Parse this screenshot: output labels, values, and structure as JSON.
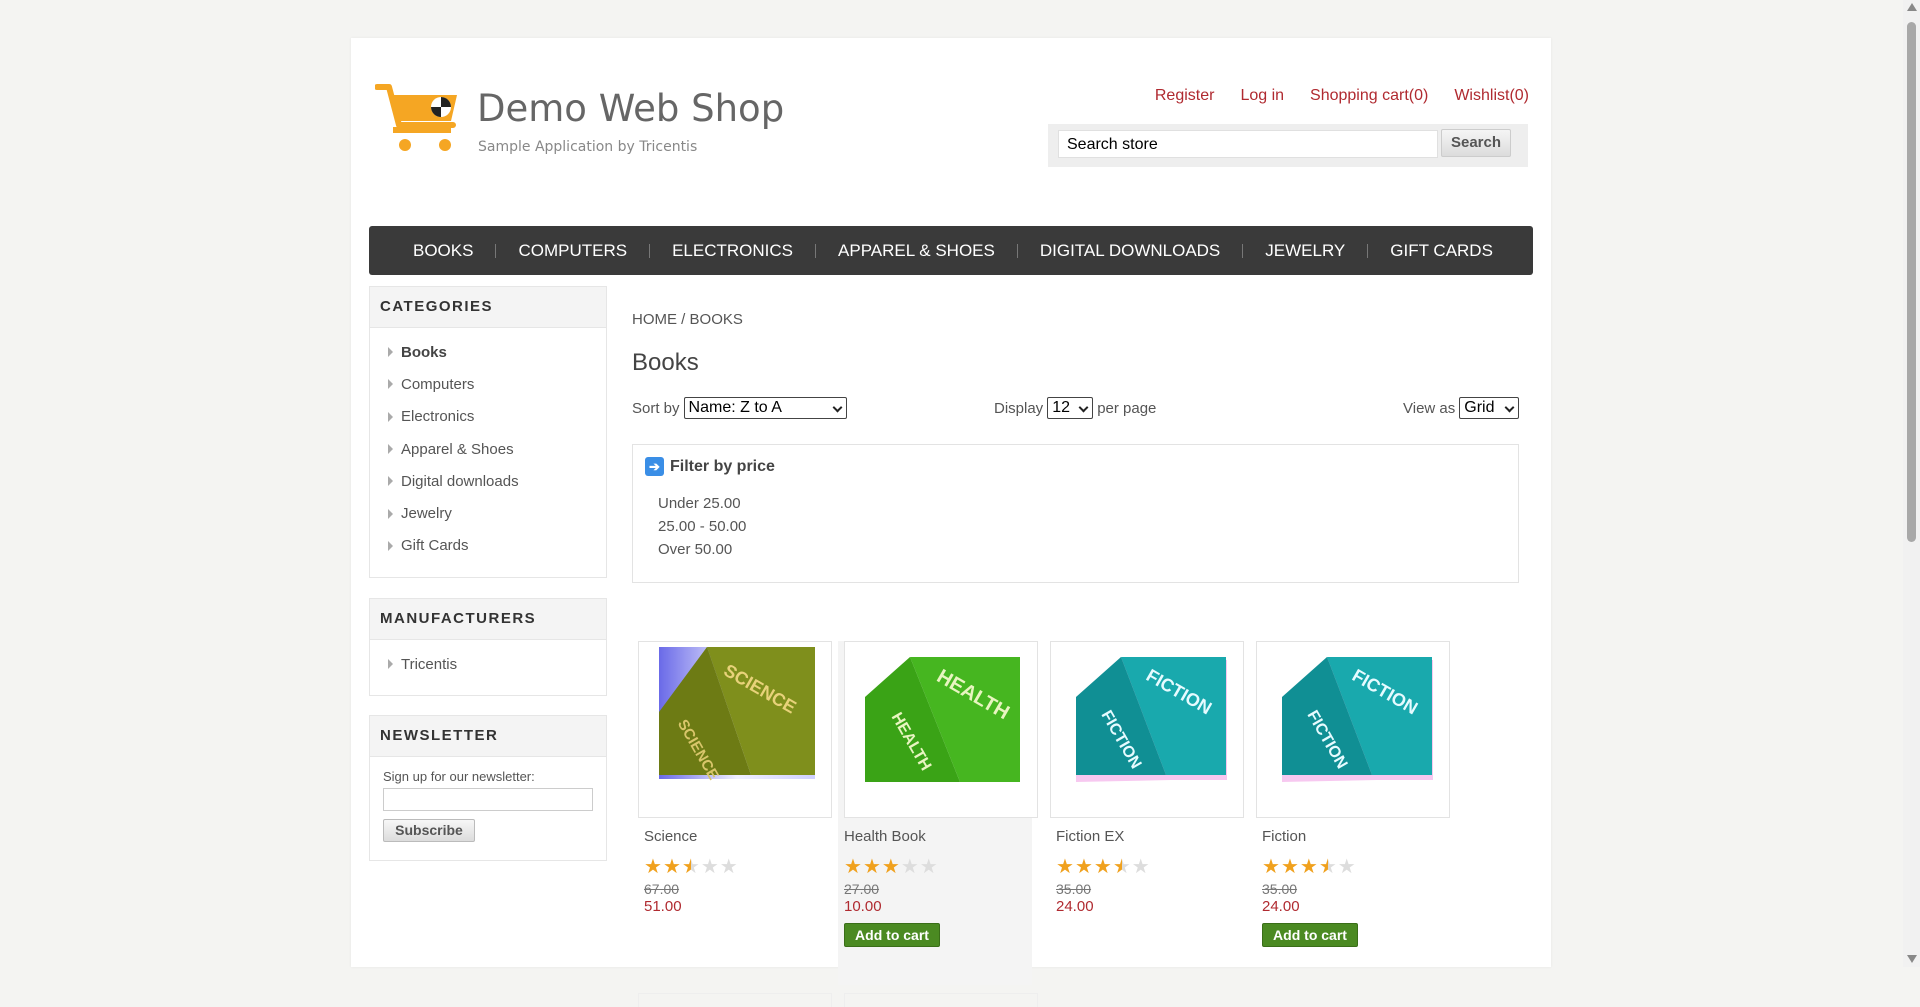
{
  "header": {
    "logo_title": "Demo Web Shop",
    "logo_subtitle": "Sample Application by Tricentis",
    "links": [
      "Register",
      "Log in",
      "Shopping cart(0)",
      "Wishlist(0)"
    ],
    "search_value": "Search store",
    "search_button": "Search"
  },
  "top_menu": [
    "BOOKS",
    "COMPUTERS",
    "ELECTRONICS",
    "APPAREL & SHOES",
    "DIGITAL DOWNLOADS",
    "JEWELRY",
    "GIFT CARDS"
  ],
  "categories": {
    "title": "CATEGORIES",
    "items": [
      "Books",
      "Computers",
      "Electronics",
      "Apparel & Shoes",
      "Digital downloads",
      "Jewelry",
      "Gift Cards"
    ],
    "active": "Books"
  },
  "manufacturers": {
    "title": "MANUFACTURERS",
    "items": [
      "Tricentis"
    ]
  },
  "newsletter": {
    "title": "NEWSLETTER",
    "label": "Sign up for our newsletter:",
    "button": "Subscribe"
  },
  "breadcrumb": {
    "home": "HOME",
    "sep": "/",
    "current": "BOOKS"
  },
  "page_title": "Books",
  "controls": {
    "sort_label": "Sort by",
    "sort_value": "Name: Z to A",
    "display_label": "Display",
    "display_value": "12",
    "per_page": "per page",
    "view_label": "View as",
    "view_value": "Grid"
  },
  "filter": {
    "title": "Filter by price",
    "items": [
      "Under 25.00",
      "25.00 - 50.00",
      "Over 50.00"
    ]
  },
  "products": [
    {
      "name": "Science",
      "rating": 2.5,
      "old_price": "67.00",
      "price": "51.00",
      "cover_text": "SCIENCE",
      "cover_color": "#7a8a1a",
      "add_to_cart": ""
    },
    {
      "name": "Health Book",
      "rating": 3,
      "old_price": "27.00",
      "price": "10.00",
      "cover_text": "HEALTH",
      "cover_color": "#3fae1e",
      "add_to_cart": "Add to cart"
    },
    {
      "name": "Fiction EX",
      "rating": 3.5,
      "old_price": "35.00",
      "price": "24.00",
      "cover_text": "FICTION",
      "cover_color": "#15a3a8",
      "add_to_cart": ""
    },
    {
      "name": "Fiction",
      "rating": 3.5,
      "old_price": "35.00",
      "price": "24.00",
      "cover_text": "FICTION",
      "cover_color": "#15a3a8",
      "add_to_cart": "Add to cart"
    }
  ],
  "colors": {
    "link": "#b02a30",
    "menu_bg": "#3a3a3a",
    "add_to_cart_bg": "#4b8a22",
    "star": "#f0a11e",
    "logo_cart": "#f5a623"
  }
}
